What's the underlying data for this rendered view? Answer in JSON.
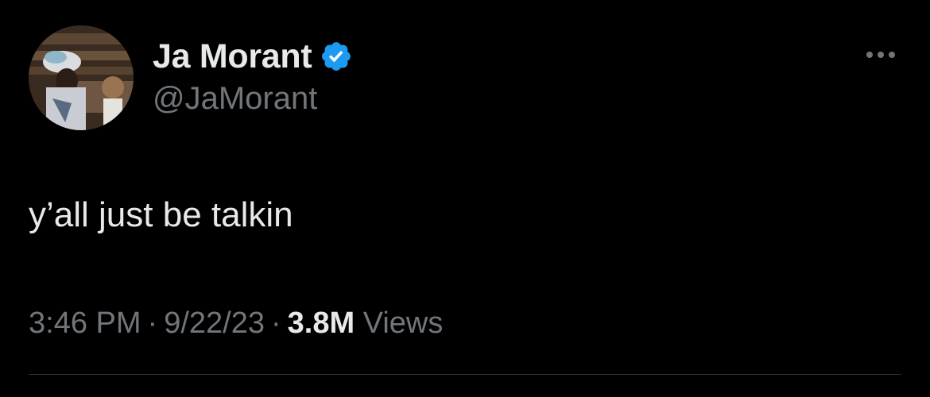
{
  "author": {
    "display_name": "Ja Morant",
    "handle": "@JaMorant",
    "verified": true,
    "avatar_icon": "profile-photo",
    "verified_icon": "verified-badge-icon",
    "verified_color": "#1d9bf0"
  },
  "tweet": {
    "text": "y’all just be talkin"
  },
  "meta": {
    "time": "3:46 PM",
    "date": "9/22/23",
    "separator": "·",
    "views_count": "3.8M",
    "views_label": "Views"
  },
  "more_icon": "more-options-icon",
  "colors": {
    "background": "#000000",
    "primary_text": "#e7e9ea",
    "secondary_text": "#71767b",
    "divider": "#2f3336"
  }
}
